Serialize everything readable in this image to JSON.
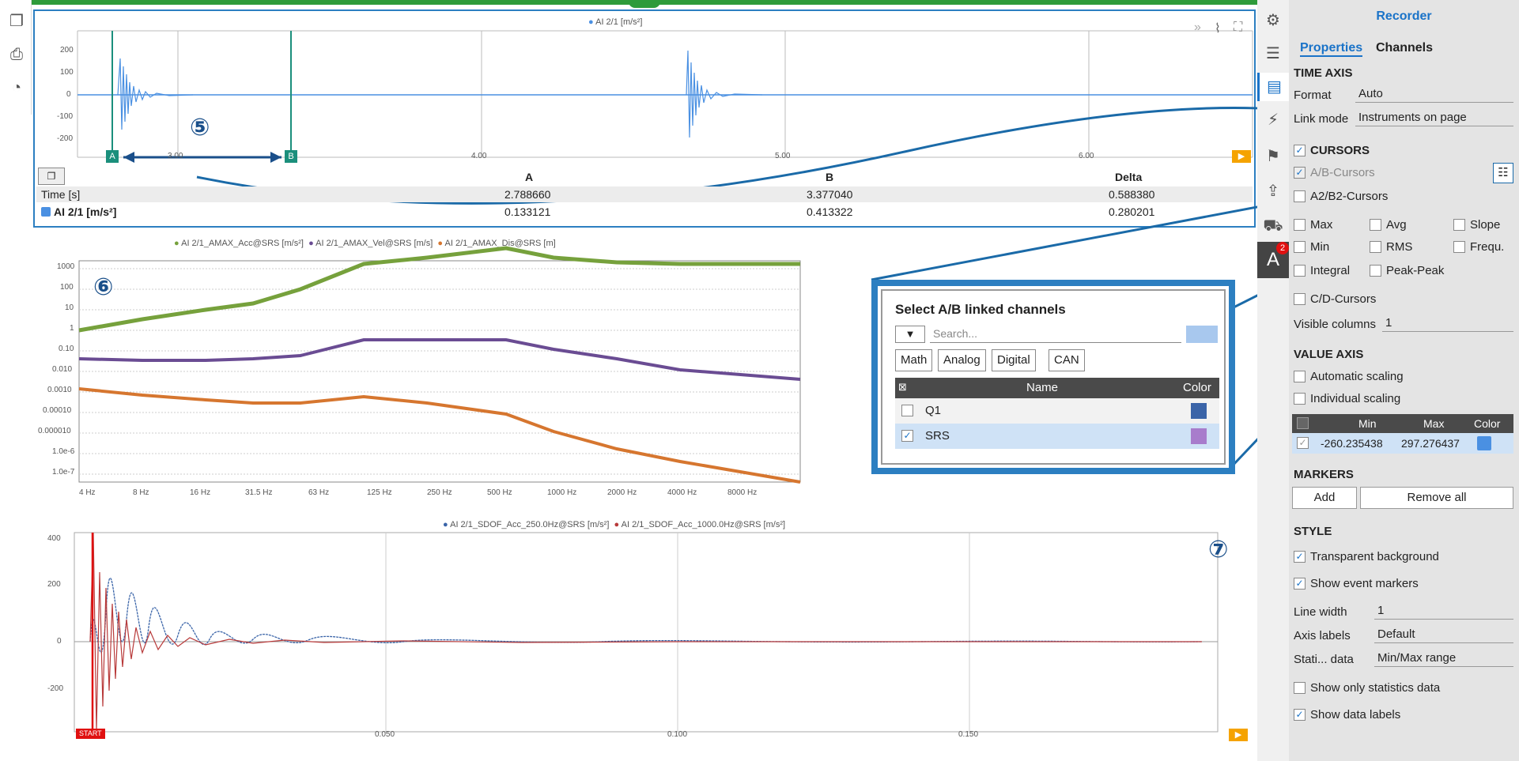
{
  "left_tools": {
    "icons": [
      "windows-icon",
      "print-icon",
      "gauge-icon"
    ]
  },
  "top_chart": {
    "legend": "AI 2/1 [m/s²]",
    "legend_color": "#4a90e2",
    "y_ticks": [
      "200",
      "100",
      "0",
      "-100",
      "-200"
    ],
    "x_ticks": [
      "3.00",
      "4.00",
      "5.00",
      "6.00"
    ],
    "cursor_a": "A",
    "cursor_b": "B",
    "annotation": "⑤",
    "table": {
      "headers": [
        "A",
        "B",
        "Delta"
      ],
      "row_time": {
        "label": "Time [s]",
        "a": "2.788660",
        "b": "3.377040",
        "delta": "0.588380"
      },
      "row_ch": {
        "label": "AI 2/1 [m/s²]",
        "a": "0.133121",
        "b": "0.413322",
        "delta": "0.280201"
      }
    }
  },
  "srs_chart": {
    "legend": [
      "AI 2/1_AMAX_Acc@SRS [m/s²]",
      "AI 2/1_AMAX_Vel@SRS [m/s]",
      "AI 2/1_AMAX_Dis@SRS [m]"
    ],
    "legend_colors": [
      "#76a13c",
      "#6a4c93",
      "#d6762f"
    ],
    "y_ticks": [
      "1000",
      "100",
      "10",
      "1",
      "0.10",
      "0.010",
      "0.0010",
      "0.00010",
      "0.000010",
      "1.0e-6",
      "1.0e-7"
    ],
    "x_ticks": [
      "4 Hz",
      "8 Hz",
      "16 Hz",
      "31.5 Hz",
      "63 Hz",
      "125 Hz",
      "250 Hz",
      "500 Hz",
      "1000 Hz",
      "2000 Hz",
      "4000 Hz",
      "8000 Hz"
    ],
    "annotation": "⑥"
  },
  "sdof_chart": {
    "legend": [
      "AI 2/1_SDOF_Acc_250.0Hz@SRS [m/s²]",
      "AI 2/1_SDOF_Acc_1000.0Hz@SRS [m/s²]"
    ],
    "legend_colors": [
      "#3a64a8",
      "#b83a3a"
    ],
    "y_ticks": [
      "400",
      "200",
      "0",
      "-200"
    ],
    "x_ticks": [
      "0.050",
      "0.100",
      "0.150"
    ],
    "start_label": "START",
    "annotation": "⑦"
  },
  "popup": {
    "title": "Select A/B linked channels",
    "search_placeholder": "Search...",
    "filters": [
      "Math",
      "Analog",
      "Digital",
      "CAN"
    ],
    "col_name": "Name",
    "col_color": "Color",
    "rows": [
      {
        "name": "Q1",
        "checked": false,
        "color": "#3a64a8"
      },
      {
        "name": "SRS",
        "checked": true,
        "color": "#a87ccc"
      }
    ]
  },
  "panel": {
    "title": "Recorder",
    "tabs": [
      "Properties",
      "Channels"
    ],
    "time_axis": "TIME AXIS",
    "format_label": "Format",
    "format_value": "Auto",
    "linkmode_label": "Link mode",
    "linkmode_value": "Instruments on page",
    "cursors": "CURSORS",
    "ab_cursors": "A/B-Cursors",
    "a2b2_cursors": "A2/B2-Cursors",
    "stats": [
      "Max",
      "Avg",
      "Slope",
      "Min",
      "RMS",
      "Frequ.",
      "Integral",
      "Peak-Peak"
    ],
    "cd_cursors": "C/D-Cursors",
    "visible_columns_label": "Visible columns",
    "visible_columns_value": "1",
    "value_axis": "VALUE AXIS",
    "auto_scaling": "Automatic scaling",
    "indiv_scaling": "Individual scaling",
    "scale_headers": [
      "Min",
      "Max",
      "Color"
    ],
    "scale_min": "-260.235438",
    "scale_max": "297.276437",
    "markers": "MARKERS",
    "add": "Add",
    "remove_all": "Remove all",
    "style": "STYLE",
    "transparent_bg": "Transparent background",
    "show_event_markers": "Show event markers",
    "line_width_label": "Line width",
    "line_width_value": "1",
    "axis_labels_label": "Axis labels",
    "axis_labels_value": "Default",
    "stati_label": "Stati... data",
    "stati_value": "Min/Max range",
    "show_only_stats": "Show only statistics data",
    "show_data_labels": "Show data labels",
    "badge": "2"
  }
}
